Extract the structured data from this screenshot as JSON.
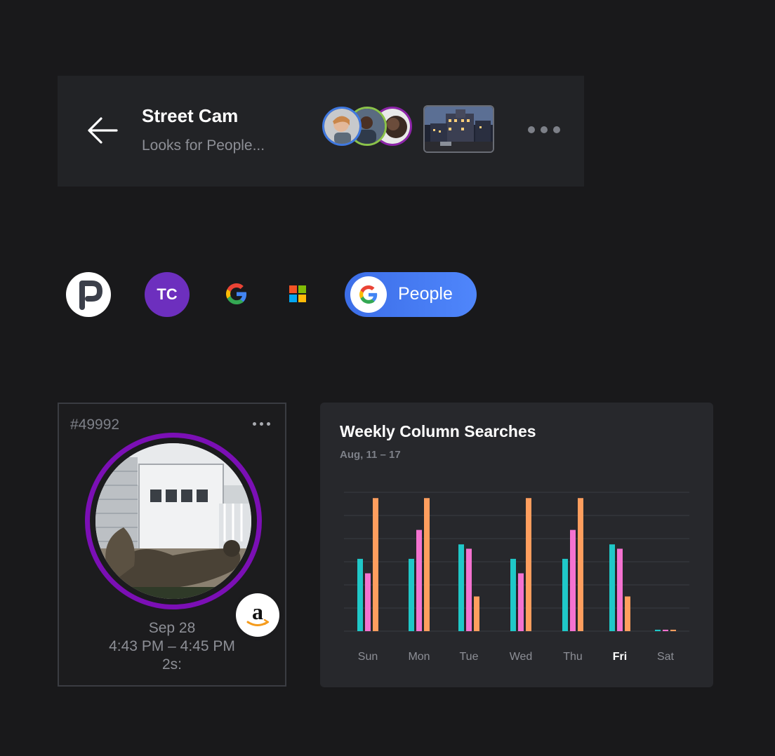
{
  "header": {
    "title": "Street Cam",
    "subtitle": "Looks for People...",
    "avatar_ring_colors": [
      "#3f78e0",
      "#8bc34a",
      "#8e24aa"
    ],
    "back_icon": "arrow-left-icon",
    "more_icon": "more-horizontal-icon"
  },
  "integrations": {
    "items": [
      "p-logo-icon",
      "google-icon",
      "microsoft-icon"
    ],
    "tc_label": "TC",
    "people_button_label": "People"
  },
  "event": {
    "id": "#49992",
    "date": "Sep 28",
    "time": "4:43 PM – 4:45 PM",
    "duration": "2s:",
    "ring_color": "#7b0fb5",
    "badge_icon": "amazon-icon"
  },
  "chart_data": {
    "type": "bar",
    "title": "Weekly Column Searches",
    "subtitle": "Aug, 11 – 17",
    "categories": [
      "Sun",
      "Mon",
      "Tue",
      "Wed",
      "Thu",
      "Fri",
      "Sat"
    ],
    "highlight_category": "Fri",
    "series": [
      {
        "values": [
          5,
          5,
          6,
          5,
          5,
          6,
          0.1
        ],
        "color": "#1fc8c8"
      },
      {
        "values": [
          4,
          7,
          5.7,
          4,
          7,
          5.7,
          0.1
        ],
        "color": "#f472d0"
      },
      {
        "values": [
          9.2,
          9.2,
          2.4,
          9.2,
          9.2,
          2.4,
          0.1
        ],
        "color": "#ff9e5e"
      }
    ],
    "ylim": [
      0,
      9.6
    ],
    "grid": true,
    "legend": "none"
  }
}
